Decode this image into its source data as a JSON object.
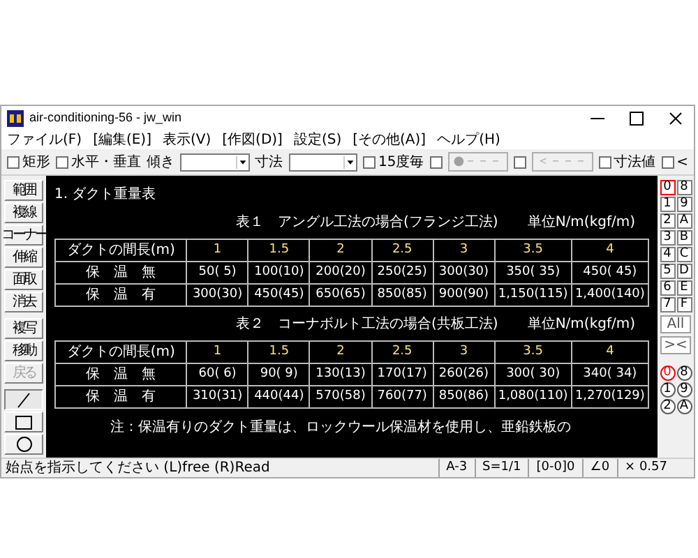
{
  "window": {
    "title": "air-conditioning-56 - jw_win"
  },
  "menu": [
    "ファイル(F)",
    "[編集(E)]",
    "表示(V)",
    "[作図(D)]",
    "設定(S)",
    "[その他(A)]",
    "ヘルプ(H)"
  ],
  "toolbar": [
    {
      "kind": "checkbox",
      "label": "矩形",
      "checked": false
    },
    {
      "kind": "checkbox",
      "label": "水平・垂直",
      "checked": false
    },
    {
      "kind": "label",
      "label": "傾き"
    },
    {
      "kind": "dropdown"
    },
    {
      "kind": "label",
      "label": "寸法"
    },
    {
      "kind": "dropdown"
    },
    {
      "kind": "checkbox",
      "label": "15度毎",
      "checked": false
    },
    {
      "kind": "checkbox",
      "checked": false
    },
    {
      "kind": "button",
      "label": "●－－－",
      "disabled": true
    },
    {
      "kind": "checkbox",
      "checked": false
    },
    {
      "kind": "button",
      "label": "＜－－－",
      "disabled": true
    },
    {
      "kind": "checkbox",
      "label": "寸法値",
      "checked": false
    },
    {
      "kind": "checkbox",
      "label": "<",
      "checked": false
    }
  ],
  "left_tools": [
    {
      "kind": "text",
      "label": "範囲",
      "selected": false,
      "disabled": false
    },
    {
      "kind": "text",
      "label": "複線",
      "selected": false,
      "disabled": false
    },
    {
      "kind": "text",
      "label": "コーナー",
      "selected": false,
      "disabled": false
    },
    {
      "kind": "text",
      "label": "伸縮",
      "selected": false,
      "disabled": false
    },
    {
      "kind": "text",
      "label": "面取",
      "selected": false,
      "disabled": false
    },
    {
      "kind": "text",
      "label": "消去",
      "selected": false,
      "disabled": false
    },
    {
      "kind": "text",
      "label": "複写",
      "selected": false,
      "disabled": false
    },
    {
      "kind": "text",
      "label": "移動",
      "selected": false,
      "disabled": false
    },
    {
      "kind": "text",
      "label": "戻る",
      "selected": false,
      "disabled": true
    },
    {
      "kind": "line",
      "selected": true
    },
    {
      "kind": "rect",
      "selected": false
    },
    {
      "kind": "circle",
      "selected": false
    }
  ],
  "canvas": {
    "heading": "1. ダクト重量表",
    "tables": [
      {
        "caption": "表１　アングル工法の場合(フランジ工法)",
        "unit": "単位N/m(kgf/m)",
        "header": [
          "ダクトの間長(m)",
          "1",
          "1.5",
          "2",
          "2.5",
          "3",
          "3.5",
          "4"
        ],
        "rows": [
          [
            "保　温　無",
            "50( 5)",
            "100(10)",
            "200(20)",
            "250(25)",
            "300(30)",
            "350( 35)",
            "450( 45)"
          ],
          [
            "保　温　有",
            "300(30)",
            "450(45)",
            "650(65)",
            "850(85)",
            "900(90)",
            "1,150(115)",
            "1,400(140)"
          ]
        ]
      },
      {
        "caption": "表２　コーナボルト工法の場合(共板工法)",
        "unit": "単位N/m(kgf/m)",
        "header": [
          "ダクトの間長(m)",
          "1",
          "1.5",
          "2",
          "2.5",
          "3",
          "3.5",
          "4"
        ],
        "rows": [
          [
            "保　温　無",
            "60( 6)",
            "90( 9)",
            "130(13)",
            "170(17)",
            "260(26)",
            "300( 30)",
            "340( 34)"
          ],
          [
            "保　温　有",
            "310(31)",
            "440(44)",
            "570(58)",
            "760(77)",
            "850(86)",
            "1,080(110)",
            "1,270(129)"
          ]
        ]
      }
    ],
    "note": "注：保温有りのダクト重量は、ロックウール保温材を使用し、亜鉛鉄板の"
  },
  "layers": [
    {
      "label": "0",
      "selected": true
    },
    {
      "label": "8",
      "selected": false
    },
    {
      "label": "1",
      "selected": false
    },
    {
      "label": "9",
      "selected": false
    },
    {
      "label": "2",
      "selected": false
    },
    {
      "label": "A",
      "selected": false
    },
    {
      "label": "3",
      "selected": false
    },
    {
      "label": "B",
      "selected": false
    },
    {
      "label": "4",
      "selected": false
    },
    {
      "label": "C",
      "selected": false
    },
    {
      "label": "5",
      "selected": false
    },
    {
      "label": "D",
      "selected": false
    },
    {
      "label": "6",
      "selected": false
    },
    {
      "label": "E",
      "selected": false
    },
    {
      "label": "7",
      "selected": false
    },
    {
      "label": "F",
      "selected": false
    }
  ],
  "layer_buttons": [
    "All",
    "><"
  ],
  "groups": [
    {
      "label": "0",
      "selected": true
    },
    {
      "label": "8",
      "selected": false
    },
    {
      "label": "1",
      "selected": false
    },
    {
      "label": "9",
      "selected": false
    },
    {
      "label": "2",
      "selected": false
    },
    {
      "label": "A",
      "selected": false
    }
  ],
  "status_bar": {
    "message": "始点を指示してください (L)free (R)Read",
    "fields": [
      "A-3",
      "S=1/1",
      "[0-0]0",
      "∠0",
      "× 0.57"
    ]
  }
}
